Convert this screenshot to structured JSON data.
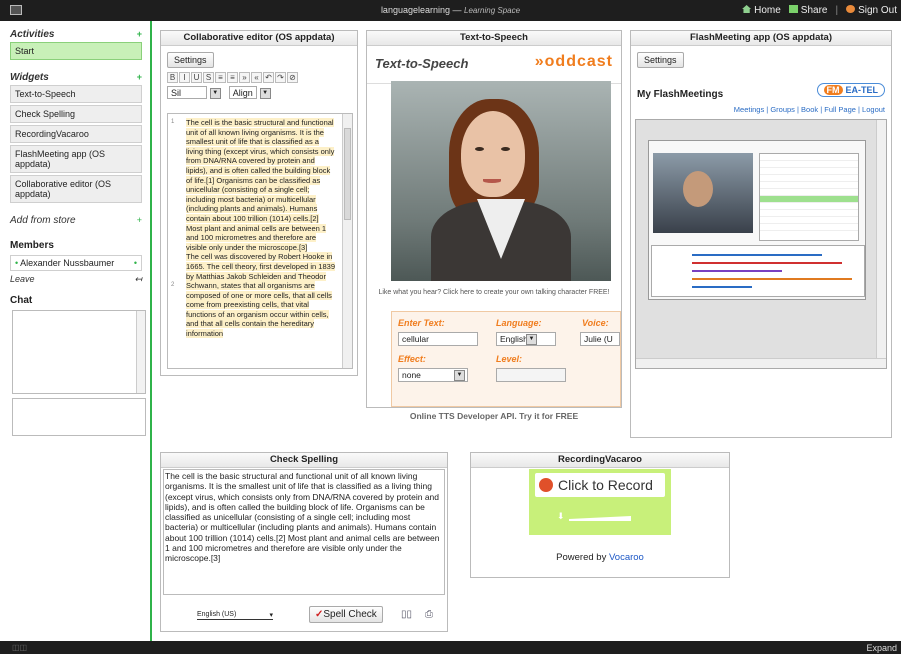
{
  "topbar": {
    "app_title": "languagelearning",
    "app_subtitle": "Learning Space",
    "home": "Home",
    "share": "Share",
    "sign_out": "Sign Out"
  },
  "sidebar": {
    "activities_header": "Activities",
    "activities": [
      "Start"
    ],
    "widgets_header": "Widgets",
    "widgets": [
      "Text-to-Speech",
      "Check Spelling",
      "RecordingVacaroo",
      "FlashMeeting app (OS appdata)",
      "Collaborative editor (OS appdata)"
    ],
    "add_from_store": "Add from store",
    "members_header": "Members",
    "member": "Alexander Nussbaumer",
    "leave": "Leave",
    "chat_header": "Chat"
  },
  "editor": {
    "title": "Collaborative editor (OS appdata)",
    "settings": "Settings",
    "font": "Sil",
    "align": "Align",
    "text": "The cell is the basic structural and functional unit of all known living organisms. It is the smallest unit of life that is classified as a living thing (except virus, which consists only from DNA/RNA covered by protein and lipids), and is often called the building block of life.[1] Organisms can be classified as unicellular (consisting of a single cell; including most bacteria) or multicellular (including plants and animals). Humans contain about 100 trillion (1014) cells.[2] Most plant and animal cells are between 1 and 100 micrometres and therefore are visible only under the microscope.[3]",
    "text2": "The cell was discovered by Robert Hooke in 1665. The cell theory, first developed in 1839 by Matthias Jakob Schleiden and Theodor Schwann, states that all organisms are composed of one or more cells, that all cells come from preexisting cells, that vital functions of an organism occur within cells, and that all cells contain the hereditary information"
  },
  "tts": {
    "title": "Text-to-Speech",
    "logo": "Text-to-Speech",
    "brand": "»oddcast",
    "promo": "Like what you hear? Click here to create your own talking character FREE!",
    "enter_text_label": "Enter Text:",
    "enter_text_value": "cellular",
    "language_label": "Language:",
    "language_value": "English",
    "voice_label": "Voice:",
    "voice_value": "Julie (U",
    "effect_label": "Effect:",
    "effect_value": "none",
    "level_label": "Level:",
    "api": "Online TTS Developer API. Try it for FREE"
  },
  "flash": {
    "title": "FlashMeeting app (OS appdata)",
    "settings": "Settings",
    "heading": "My FlashMeetings",
    "badge_fm": "FM",
    "badge_text": "EA-TEL",
    "links": "Meetings | Groups | Book | Full Page | Logout"
  },
  "spell": {
    "title": "Check Spelling",
    "text": "The cell is the basic structural and functional unit of all known living organisms. It is the smallest unit of life that is classified as a living thing (except virus, which consists only from DNA/RNA covered by protein and lipids), and is often called the building block of life. Organisms can be classified as unicellular (consisting of a single cell; including most bacteria) or multicellular (including plants and animals). Humans contain about 100 trillion (1014) cells.[2] Most plant and animal cells are between 1 and 100 micrometres and therefore are visible only under the microscope.[3]",
    "language": "English (US)",
    "button": "Spell Check"
  },
  "record": {
    "title": "RecordingVacaroo",
    "button": "Click to Record",
    "powered_prefix": "Powered by",
    "powered_brand": "Vocaroo"
  },
  "bottombar": {
    "expand": "Expand"
  }
}
